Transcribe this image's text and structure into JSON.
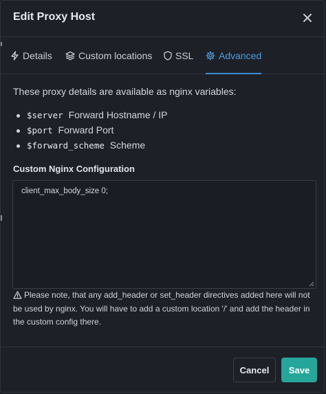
{
  "modal": {
    "title": "Edit Proxy Host"
  },
  "tabs": [
    {
      "label": "Details",
      "icon": "lightning-icon",
      "active": false
    },
    {
      "label": "Custom locations",
      "icon": "layers-icon",
      "active": false
    },
    {
      "label": "SSL",
      "icon": "shield-icon",
      "active": false
    },
    {
      "label": "Advanced",
      "icon": "gear-icon",
      "active": true
    }
  ],
  "advanced": {
    "intro": "These proxy details are available as nginx variables:",
    "variables": [
      {
        "code": "$server",
        "desc": "Forward Hostname / IP"
      },
      {
        "code": "$port",
        "desc": "Forward Port"
      },
      {
        "code": "$forward_scheme",
        "desc": "Scheme"
      }
    ],
    "config_label": "Custom Nginx Configuration",
    "config_value": "client_max_body_size 0;",
    "warning": "Please note, that any add_header or set_header directives added here will not be used by nginx. You will have to add a custom location '/' and add the header in the custom config there."
  },
  "footer": {
    "cancel_label": "Cancel",
    "save_label": "Save"
  },
  "colors": {
    "accent": "#3d8fd6",
    "save_button": "#26a69a",
    "background": "#1d2027"
  }
}
